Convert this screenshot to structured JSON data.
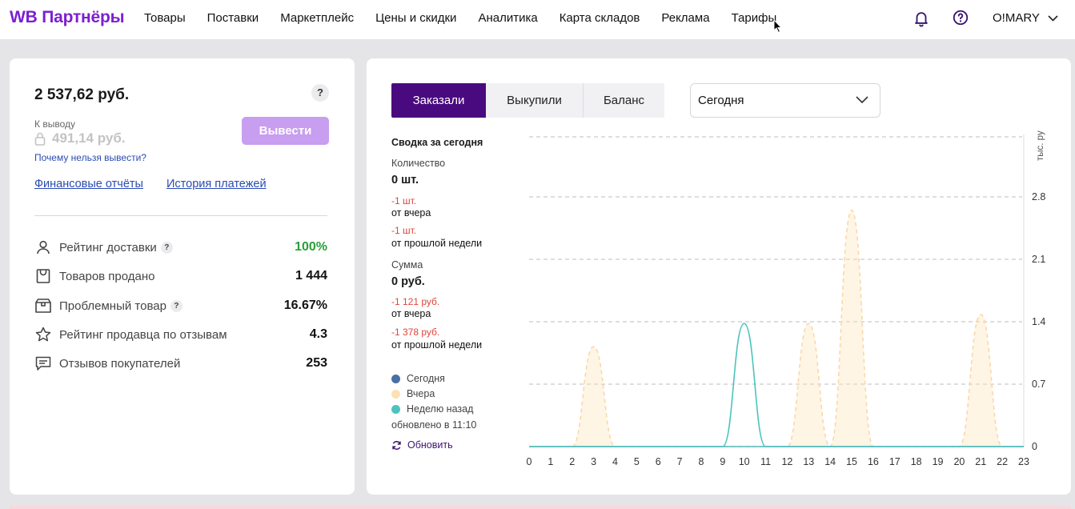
{
  "header": {
    "logo": "WB Партнёры",
    "nav": [
      "Товары",
      "Поставки",
      "Маркетплейс",
      "Цены и скидки",
      "Аналитика",
      "Карта складов",
      "Реклама",
      "Тарифы"
    ],
    "user": "O!MARY"
  },
  "balance_card": {
    "balance": "2 537,62 руб.",
    "payout_label": "К выводу",
    "payout_value": "491,14 руб.",
    "why_link": "Почему нельзя вывести?",
    "withdraw_button": "Вывести",
    "reports_link": "Финансовые отчёты",
    "history_link": "История платежей",
    "help": "?",
    "metrics": [
      {
        "label": "Рейтинг доставки",
        "value": "100%",
        "help": "?",
        "icon": "person-icon"
      },
      {
        "label": "Товаров продано",
        "value": "1 444",
        "icon": "bag-icon"
      },
      {
        "label": "Проблемный товар",
        "value": "16.67%",
        "help": "?",
        "icon": "box-icon"
      },
      {
        "label": "Рейтинг продавца по отзывам",
        "value": "4.3",
        "icon": "star-icon"
      },
      {
        "label": "Отзывов покупателей",
        "value": "253",
        "icon": "comment-icon"
      }
    ]
  },
  "sales_card": {
    "tabs": [
      "Заказали",
      "Выкупили",
      "Баланс"
    ],
    "active_tab": "Заказали",
    "period": "Сегодня",
    "summary_title": "Сводка за сегодня",
    "quantity_label": "Количество",
    "quantity_value": "0 шт.",
    "quantity_vs_yesterday": "-1 шт.",
    "quantity_vs_week": "-1 шт.",
    "sum_label": "Сумма",
    "sum_value": "0 руб.",
    "sum_vs_yesterday": "-1 121 руб.",
    "sum_vs_week": "-1 378 руб.",
    "from_yesterday": "от вчера",
    "from_last_week": "от прошлой недели",
    "legend": [
      {
        "name": "Сегодня",
        "color": "#4a6fa5"
      },
      {
        "name": "Вчера",
        "color": "#fbe2b4"
      },
      {
        "name": "Неделю назад",
        "color": "#4cc3bd"
      }
    ],
    "updated": "обновлено в 11:10",
    "refresh": "Обновить"
  },
  "chart_data": {
    "type": "area",
    "ylabel": "тыс. руб.",
    "ylim": [
      0,
      3.5
    ],
    "y_ticks": [
      "0",
      "0.7",
      "1.4",
      "2.1",
      "2.8"
    ],
    "x": [
      "0",
      "1",
      "2",
      "3",
      "4",
      "5",
      "6",
      "7",
      "8",
      "9",
      "10",
      "11",
      "12",
      "13",
      "14",
      "15",
      "16",
      "17",
      "18",
      "19",
      "20",
      "21",
      "22",
      "23"
    ],
    "series": [
      {
        "name": "Сегодня",
        "values": [
          0,
          0,
          0,
          0,
          0,
          0,
          0,
          0,
          0,
          0,
          0,
          0,
          0,
          0,
          0,
          0,
          0,
          0,
          0,
          0,
          0,
          0,
          0,
          0
        ]
      },
      {
        "name": "Вчера",
        "values": [
          0,
          0,
          0,
          1.12,
          0,
          0,
          0,
          0,
          0,
          0,
          0,
          0,
          0,
          1.38,
          0,
          2.65,
          0,
          0,
          0,
          0,
          0,
          1.48,
          0,
          0
        ]
      },
      {
        "name": "Неделю назад",
        "values": [
          0,
          0,
          0,
          0,
          0,
          0,
          0,
          0,
          0,
          0,
          1.38,
          0,
          0,
          0,
          0,
          0,
          0,
          0,
          0,
          0,
          0,
          0,
          0,
          0
        ]
      }
    ]
  }
}
